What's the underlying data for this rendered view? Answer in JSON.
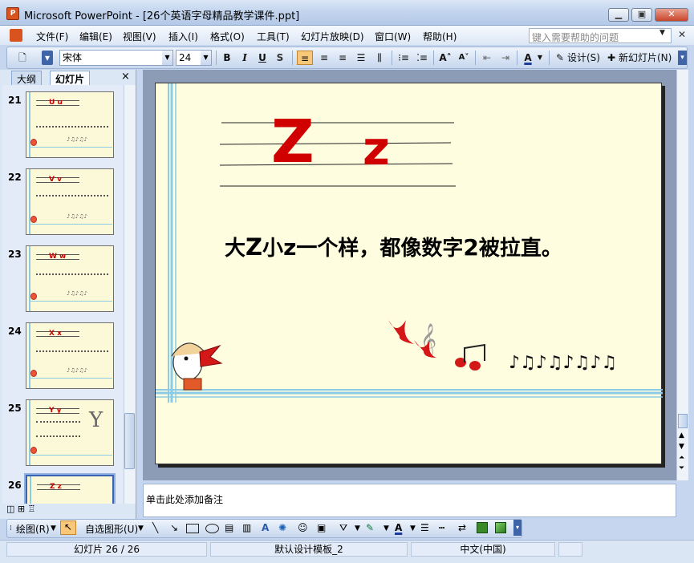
{
  "window": {
    "title": "Microsoft PowerPoint - [26个英语字母精品教学课件.ppt]",
    "minimize": "▁",
    "maximize": "▣",
    "close": "✕"
  },
  "menu": {
    "items": [
      "文件(F)",
      "编辑(E)",
      "视图(V)",
      "插入(I)",
      "格式(O)",
      "工具(T)",
      "幻灯片放映(D)",
      "窗口(W)",
      "帮助(H)"
    ],
    "help_placeholder": "键入需要帮助的问题"
  },
  "toolbar": {
    "font": "宋体",
    "size": "24",
    "bold": "B",
    "italic": "I",
    "underline": "U",
    "shadow": "S",
    "design": "设计(S)",
    "new_slide": "新幻灯片(N)"
  },
  "panel": {
    "tab_outline": "大纲",
    "tab_slides": "幻灯片",
    "close": "×",
    "thumbnails": [
      {
        "number": "21",
        "letters": "U  u"
      },
      {
        "number": "22",
        "letters": "V  v"
      },
      {
        "number": "23",
        "letters": "W  w"
      },
      {
        "number": "24",
        "letters": "X  x"
      },
      {
        "number": "25",
        "letters": "Y  y"
      },
      {
        "number": "26",
        "letters": "Z  z"
      }
    ]
  },
  "slide": {
    "big_letter": "Z",
    "small_letter": "z",
    "rhyme_parts": [
      "大",
      "Z",
      "小",
      "z",
      "一个样，都像数字",
      "2",
      "被拉直。"
    ]
  },
  "notes": {
    "placeholder": "单击此处添加备注"
  },
  "drawbar": {
    "draw": "绘图(R)",
    "autoshapes": "自选图形(U)"
  },
  "status": {
    "slide": "幻灯片 26 / 26",
    "template": "默认设计模板_2",
    "language": "中文(中国)"
  },
  "colors": {
    "letter_red": "#d00000",
    "slide_bg": "#fefde0",
    "accent_blue": "#8ccbe6"
  }
}
